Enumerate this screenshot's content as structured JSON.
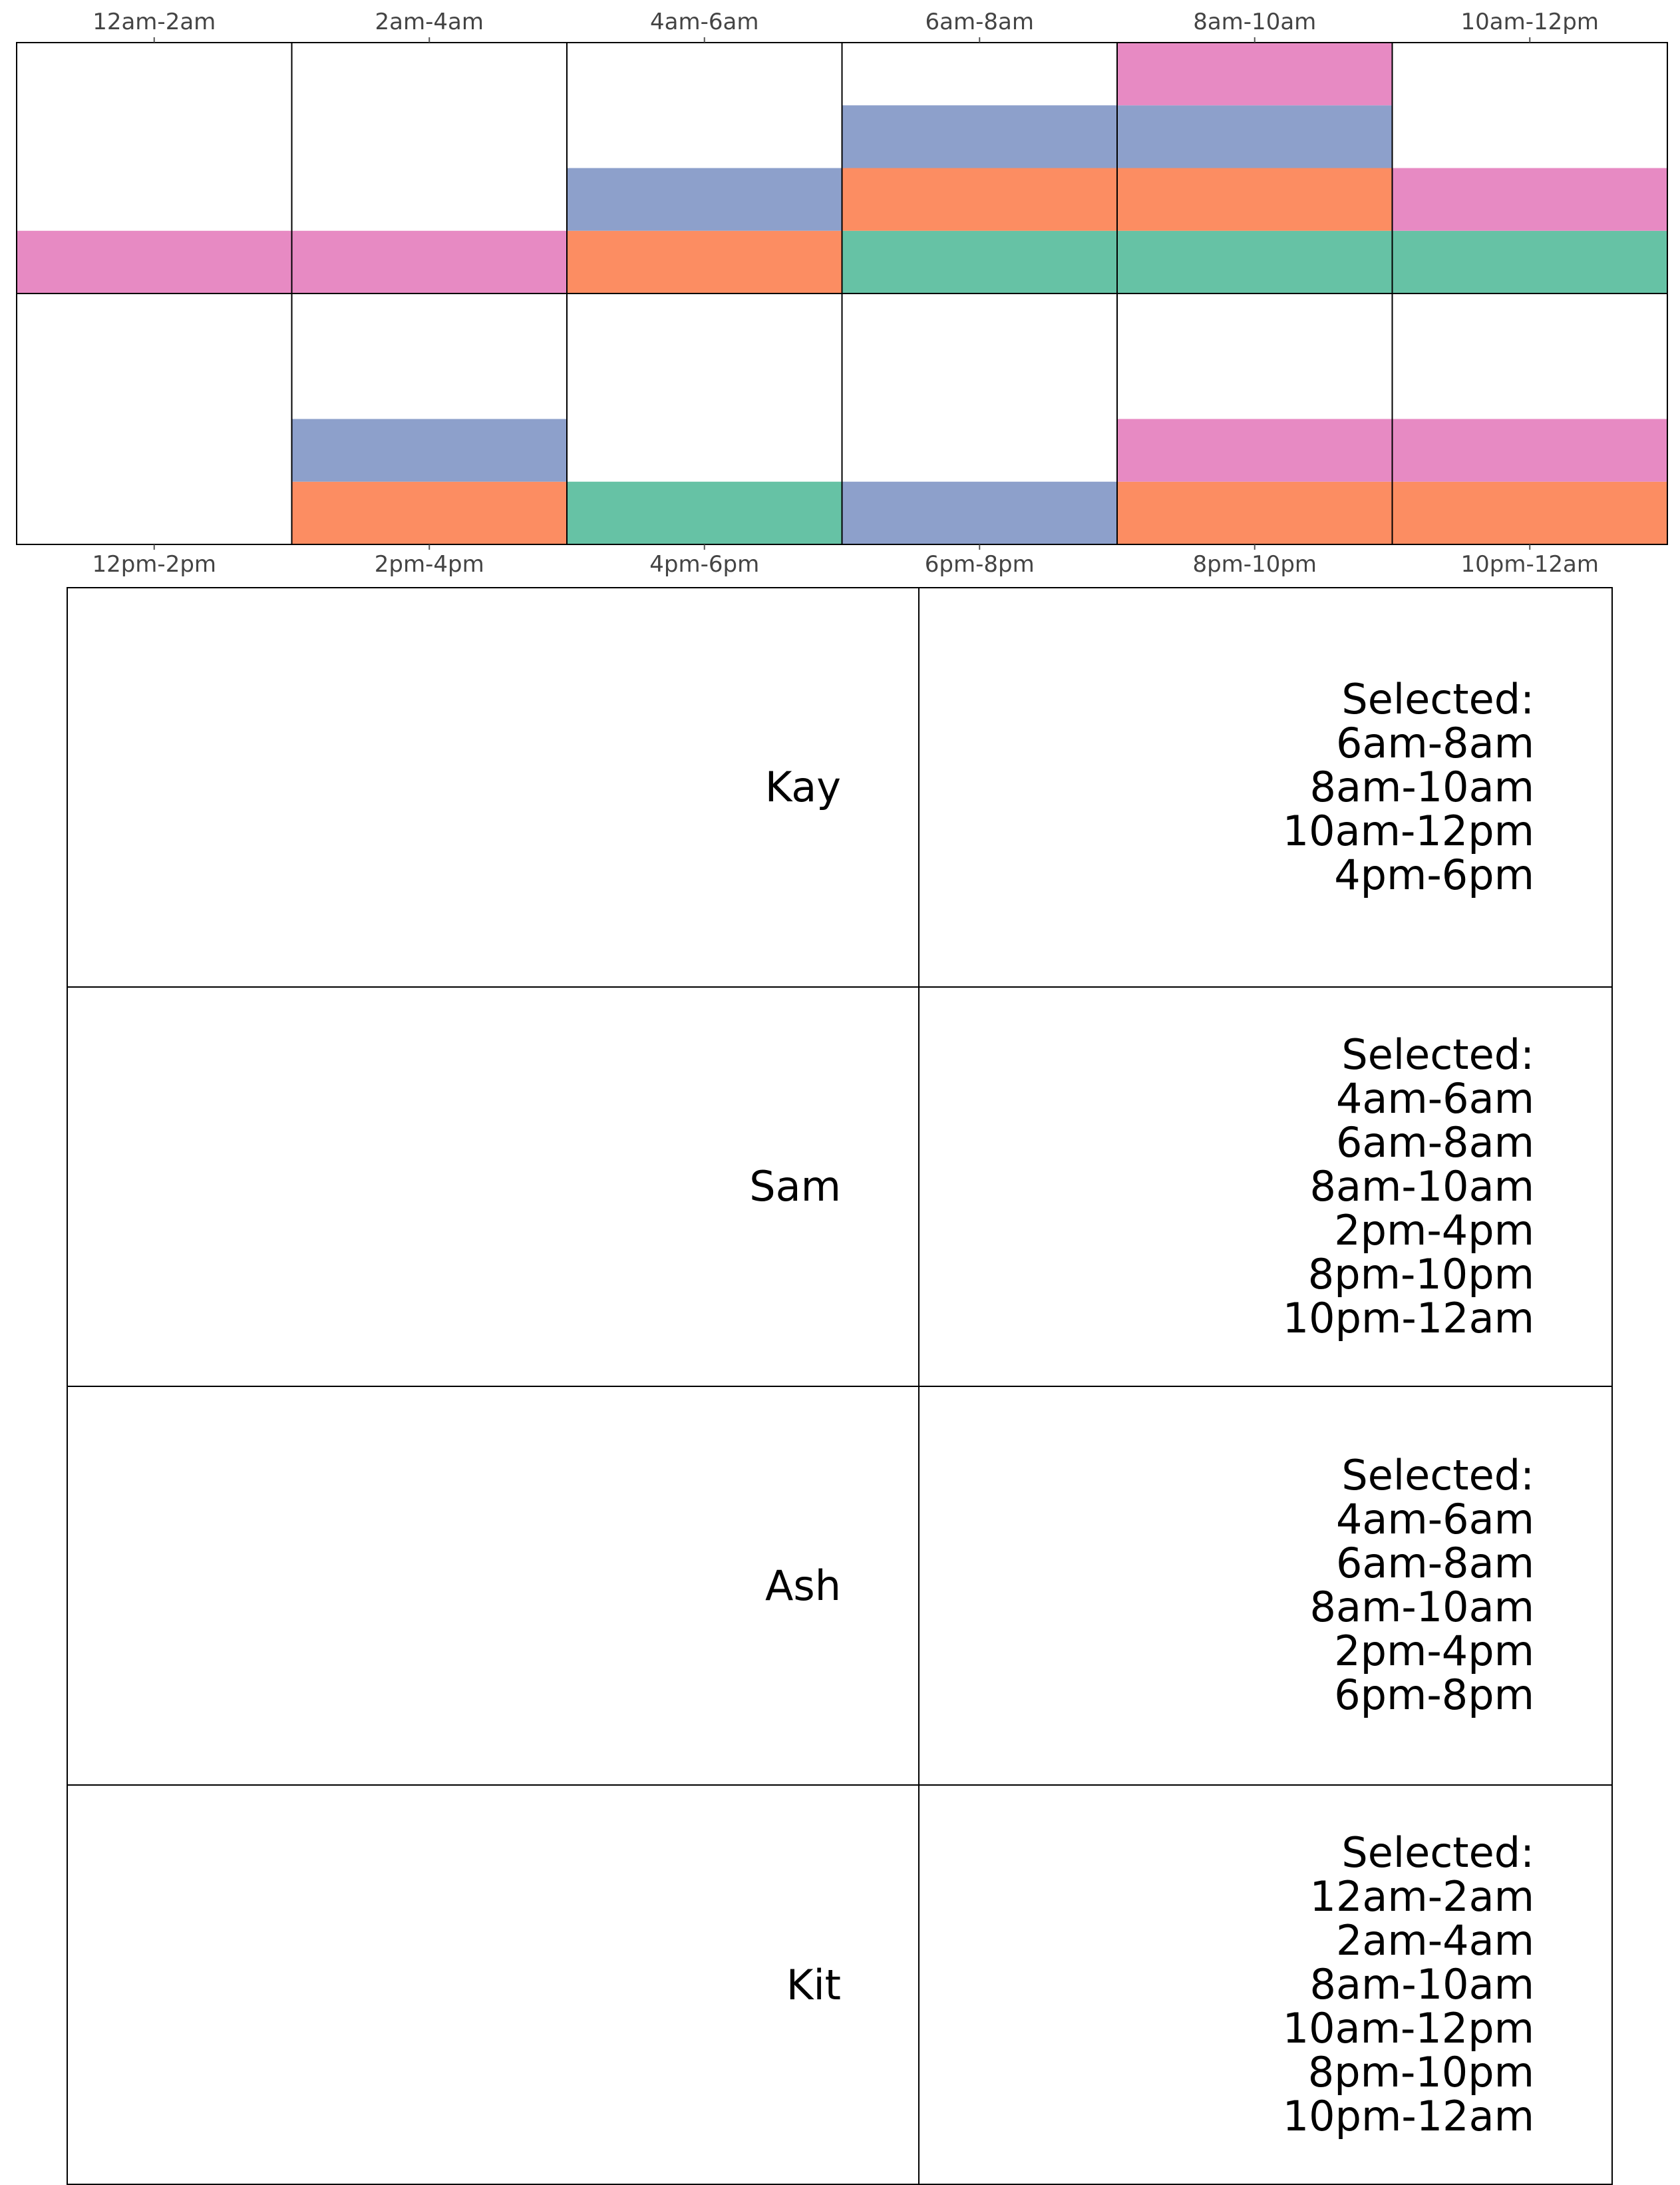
{
  "chart_data": {
    "type": "stacked-bar-grid",
    "rows": [
      {
        "slots": [
          "12am-2am",
          "2am-4am",
          "4am-6am",
          "6am-8am",
          "8am-10am",
          "10am-12pm"
        ],
        "label_position": "top"
      },
      {
        "slots": [
          "12pm-2pm",
          "2pm-4pm",
          "4pm-6pm",
          "6pm-8pm",
          "8pm-10pm",
          "10pm-12am"
        ],
        "label_position": "bottom"
      }
    ],
    "ylim": [
      0,
      4
    ],
    "grid": false,
    "series": [
      {
        "color": "#66c2a5",
        "selected": [
          "6am-8am",
          "8am-10am",
          "10am-12pm",
          "4pm-6pm"
        ]
      },
      {
        "color": "#fc8d62",
        "selected": [
          "4am-6am",
          "6am-8am",
          "8am-10am",
          "2pm-4pm",
          "8pm-10pm",
          "10pm-12am"
        ]
      },
      {
        "color": "#8da0cb",
        "selected": [
          "4am-6am",
          "6am-8am",
          "8am-10am",
          "2pm-4pm",
          "6pm-8pm"
        ]
      },
      {
        "color": "#e78ac3",
        "selected": [
          "12am-2am",
          "2am-4am",
          "8am-10am",
          "10am-12pm",
          "8pm-10pm",
          "10pm-12am"
        ]
      }
    ]
  },
  "people": [
    {
      "name": "Kay",
      "selected_heading": "Selected:",
      "selected": [
        "6am-8am",
        "8am-10am",
        "10am-12pm",
        "4pm-6pm"
      ]
    },
    {
      "name": "Sam",
      "selected_heading": "Selected:",
      "selected": [
        "4am-6am",
        "6am-8am",
        "8am-10am",
        "2pm-4pm",
        "8pm-10pm",
        "10pm-12am"
      ]
    },
    {
      "name": "Ash",
      "selected_heading": "Selected:",
      "selected": [
        "4am-6am",
        "6am-8am",
        "8am-10am",
        "2pm-4pm",
        "6pm-8pm"
      ]
    },
    {
      "name": "Kit",
      "selected_heading": "Selected:",
      "selected": [
        "12am-2am",
        "2am-4am",
        "8am-10am",
        "10am-12pm",
        "8pm-10pm",
        "10pm-12am"
      ]
    }
  ]
}
